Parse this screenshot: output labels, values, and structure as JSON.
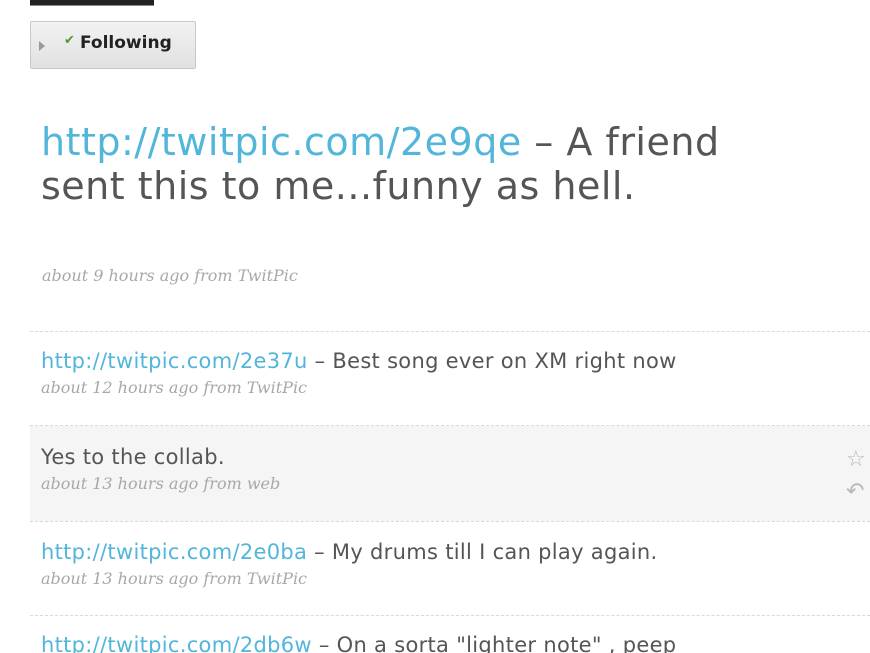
{
  "profile": {
    "follow_button": {
      "check_icon": "check-icon",
      "arrow_icon": "arrow-right-icon",
      "label": "Following"
    }
  },
  "featured_tweet": {
    "link": "http://twitpic.com/2e9qe",
    "text": " – A friend sent this to me...funny as hell.",
    "meta": "about 9 hours ago from TwitPic"
  },
  "timeline": [
    {
      "link": "http://twitpic.com/2e37u",
      "text": " – Best song ever on XM right now",
      "meta": "about 12 hours ago from TwitPic"
    },
    {
      "link": "",
      "text": "Yes to the collab.",
      "meta": "about 13 hours ago from web",
      "actions": {
        "favorite_icon": "star-icon",
        "reply_icon": "reply-icon"
      }
    },
    {
      "link": "http://twitpic.com/2e0ba",
      "text": " – My drums till I can play again.",
      "meta": "about 13 hours ago from TwitPic"
    },
    {
      "link": "http://twitpic.com/2db6w",
      "text": " – On a sorta \"lighter note\" , peep",
      "meta": ""
    }
  ],
  "colors": {
    "link": "#52b6da",
    "text": "#555555",
    "meta": "#a8a8a8",
    "hover_row": "#f5f5f5",
    "check": "#4a9a2e"
  }
}
